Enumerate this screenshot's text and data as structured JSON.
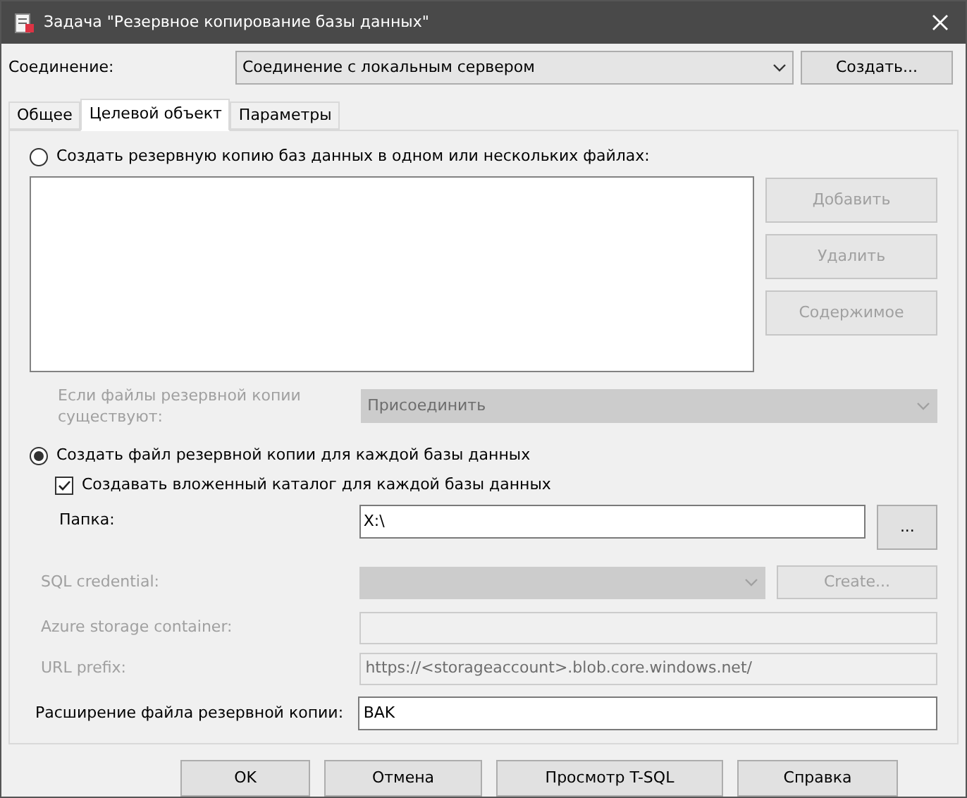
{
  "window": {
    "title": "Задача \"Резервное копирование базы данных\""
  },
  "connection": {
    "label": "Соединение:",
    "value": "Соединение с локальным сервером",
    "button": "Создать..."
  },
  "tabs": [
    {
      "label": "Общее",
      "selected": false
    },
    {
      "label": "Целевой объект",
      "selected": true
    },
    {
      "label": "Параметры",
      "selected": false
    }
  ],
  "destinations": [
    {
      "label": "Создать резервную копию баз данных в одном или нескольких файлах:",
      "selected": false
    },
    {
      "label": "Создать файл резервной копии для каждой базы данных",
      "selected": true
    }
  ],
  "file_buttons": [
    {
      "label": "Добавить",
      "disabled": true
    },
    {
      "label": "Удалить",
      "disabled": true
    },
    {
      "label": "Содержимое",
      "disabled": true
    }
  ],
  "if_exists": {
    "label": "Если файлы резервной копии существуют:",
    "value": "Присоединить",
    "disabled": true
  },
  "subfolder": {
    "label": "Создавать вложенный каталог для каждой базы данных",
    "checked": true
  },
  "folder": {
    "label": "Папка:",
    "value": "X:\\",
    "browse_button": "..."
  },
  "sql_credential": {
    "label": "SQL credential:",
    "button": "Create...",
    "disabled": true
  },
  "azure_container": {
    "label": "Azure storage container:",
    "disabled": true
  },
  "url_prefix": {
    "label": "URL prefix:",
    "value": "https://<storageaccount>.blob.core.windows.net/",
    "disabled": true
  },
  "extension": {
    "label": "Расширение файла резервной копии:",
    "value": "BAK"
  },
  "buttons": [
    "OK",
    "Отмена",
    "Просмотр T-SQL",
    "Справка"
  ]
}
